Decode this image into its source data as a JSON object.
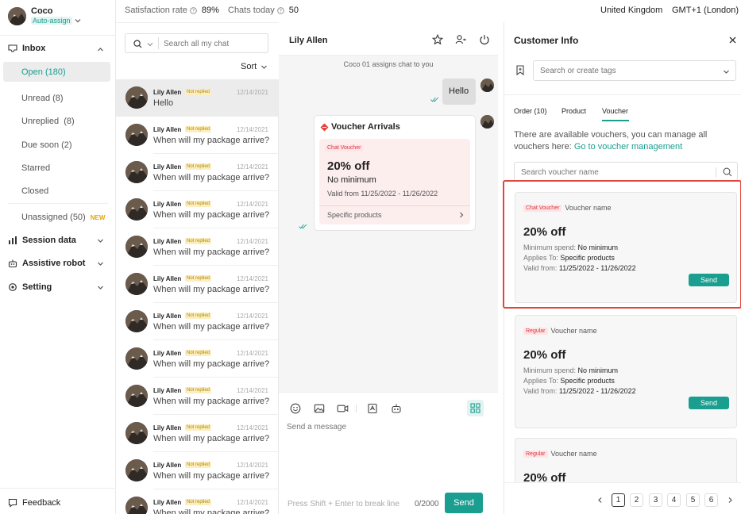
{
  "user": {
    "name": "Coco",
    "mode": "Auto-assign"
  },
  "nav": {
    "inbox": "Inbox",
    "open": "Open (180)",
    "items": [
      "Unread (8)",
      "Unreplied  (8)",
      "Due soon (2)",
      "Starred",
      "Closed"
    ],
    "unassigned": "Unassigned (50)",
    "new_badge": "NEW",
    "session_data": "Session data",
    "assistive_robot": "Assistive robot",
    "setting": "Setting",
    "feedback": "Feedback"
  },
  "topbar": {
    "satisfaction_label": "Satisfaction rate",
    "satisfaction_value": "89%",
    "chats_label": "Chats today",
    "chats_value": "50",
    "region": "United Kingdom",
    "timezone": "GMT+1 (London)"
  },
  "chatlist": {
    "search_placeholder": "Search all my chat",
    "sort_label": "Sort",
    "items": [
      {
        "name": "Lily Allen",
        "status": "Not replied",
        "date": "12/14/2021",
        "message": "Hello"
      },
      {
        "name": "Lily Allen",
        "status": "Not replied",
        "date": "12/14/2021",
        "message": "When will my package arrive?"
      },
      {
        "name": "Lily Allen",
        "status": "Not replied",
        "date": "12/14/2021",
        "message": "When will my package arrive?"
      },
      {
        "name": "Lily Allen",
        "status": "Not replied",
        "date": "12/14/2021",
        "message": "When will my package arrive?"
      },
      {
        "name": "Lily Allen",
        "status": "Not replied",
        "date": "12/14/2021",
        "message": "When will my package arrive?"
      },
      {
        "name": "Lily Allen",
        "status": "Not replied",
        "date": "12/14/2021",
        "message": "When will my package arrive?"
      },
      {
        "name": "Lily Allen",
        "status": "Not replied",
        "date": "12/14/2021",
        "message": "When will my package arrive?"
      },
      {
        "name": "Lily Allen",
        "status": "Not replied",
        "date": "12/14/2021",
        "message": "When will my package arrive?"
      },
      {
        "name": "Lily Allen",
        "status": "Not replied",
        "date": "12/14/2021",
        "message": "When will my package arrive?"
      },
      {
        "name": "Lily Allen",
        "status": "Not replied",
        "date": "12/14/2021",
        "message": "When will my package arrive?"
      },
      {
        "name": "Lily Allen",
        "status": "Not replied",
        "date": "12/14/2021",
        "message": "When will my package arrive?"
      },
      {
        "name": "Lily Allen",
        "status": "Not replied",
        "date": "12/14/2021",
        "message": "When will my package arrive?"
      }
    ]
  },
  "conversation": {
    "contact_name": "Lily Allen",
    "system_notice": "Coco 01 assigns chat to you",
    "outgoing_message": "Hello",
    "voucher_card": {
      "title": "Voucher Arrivals",
      "tag": "Chat Voucher",
      "discount": "20% off",
      "minimum": "No minimum",
      "valid": "Valid from 11/25/2022 - 11/26/2022",
      "scope": "Specific products"
    },
    "composer_placeholder": "Send a message",
    "hint": "Press Shift + Enter to break line",
    "counter": "0/2000",
    "send_label": "Send"
  },
  "info": {
    "title": "Customer Info",
    "tags_placeholder": "Search or create tags",
    "tabs": [
      "Order (10)",
      "Product",
      "Voucher"
    ],
    "notice_text": "There are available vouchers, you can manage all vouchers here:",
    "notice_link": "Go to voucher management",
    "voucher_search_placeholder": "Search voucher name",
    "vouchers": [
      {
        "tag": "Chat Voucher",
        "name": "Voucher name",
        "discount": "20% off",
        "min_label": "Minimum spend:",
        "min_value": "No minimum",
        "applies_label": "Applies To:",
        "applies_value": "Specific products",
        "valid_label": "Valid from:",
        "valid_value": "11/25/2022 - 11/26/2022",
        "send": "Send"
      },
      {
        "tag": "Regular",
        "name": "Voucher name",
        "discount": "20% off",
        "min_label": "Minimum spend:",
        "min_value": "No minimum",
        "applies_label": "Applies To:",
        "applies_value": "Specific products",
        "valid_label": "Valid from:",
        "valid_value": "11/25/2022 - 11/26/2022",
        "send": "Send"
      },
      {
        "tag": "Regular",
        "name": "Voucher name",
        "discount": "20% off"
      }
    ],
    "pages": [
      "1",
      "2",
      "3",
      "4",
      "5",
      "6"
    ]
  },
  "colors": {
    "accent": "#1a9e8f",
    "highlight": "#e0463c",
    "active_bg": "#ececec"
  }
}
